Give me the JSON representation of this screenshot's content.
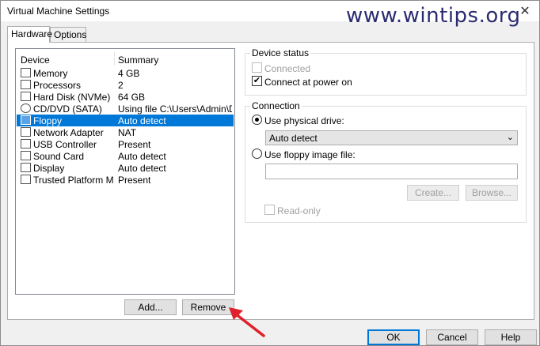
{
  "window": {
    "title": "Virtual Machine Settings",
    "close": "✕"
  },
  "watermark": "www.wintips.org",
  "tabs": [
    {
      "label": "Hardware"
    },
    {
      "label": "Options"
    }
  ],
  "device_list": {
    "headers": {
      "device": "Device",
      "summary": "Summary"
    },
    "rows": [
      {
        "name": "Memory",
        "summary": "4 GB"
      },
      {
        "name": "Processors",
        "summary": "2"
      },
      {
        "name": "Hard Disk (NVMe)",
        "summary": "64 GB"
      },
      {
        "name": "CD/DVD (SATA)",
        "summary": "Using file C:\\Users\\Admin\\Do..."
      },
      {
        "name": "Floppy",
        "summary": "Auto detect"
      },
      {
        "name": "Network Adapter",
        "summary": "NAT"
      },
      {
        "name": "USB Controller",
        "summary": "Present"
      },
      {
        "name": "Sound Card",
        "summary": "Auto detect"
      },
      {
        "name": "Display",
        "summary": "Auto detect"
      },
      {
        "name": "Trusted Platform Mo...",
        "summary": "Present"
      }
    ],
    "selected_index": 4
  },
  "buttons": {
    "add": "Add...",
    "remove": "Remove",
    "ok": "OK",
    "cancel": "Cancel",
    "help": "Help"
  },
  "device_status": {
    "legend": "Device status",
    "connected": "Connected",
    "connect_at_power_on": "Connect at power on"
  },
  "connection": {
    "legend": "Connection",
    "use_physical": "Use physical drive:",
    "physical_value": "Auto detect",
    "use_image": "Use floppy image file:",
    "image_path": "",
    "create": "Create...",
    "browse": "Browse...",
    "read_only": "Read-only"
  },
  "check_mark": "✔",
  "dropdown_arrow": "⌄",
  "colors": {
    "selection": "#0078d7",
    "annotation_arrow": "#e0202a"
  }
}
